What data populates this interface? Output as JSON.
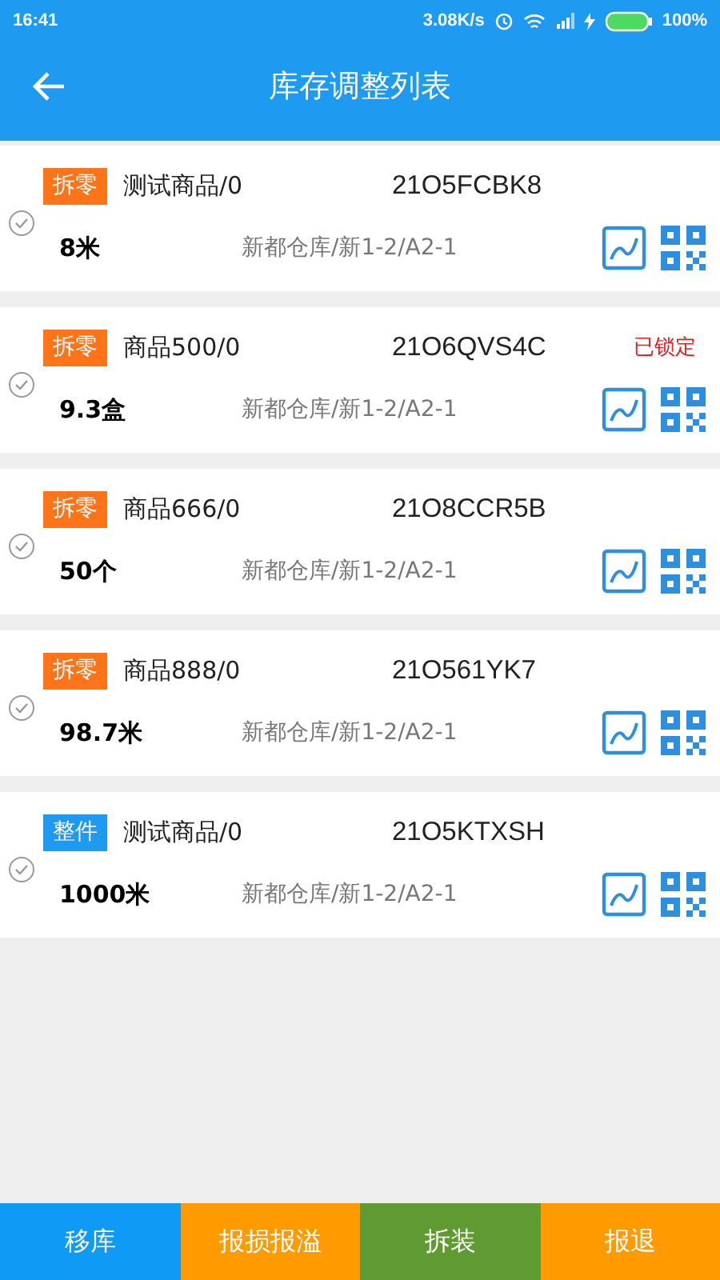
{
  "status_bar": {
    "time": "16:41",
    "speed": "3.08K/s",
    "battery": "100%"
  },
  "header": {
    "title": "库存调整列表"
  },
  "items": [
    {
      "tag": {
        "label": "拆零",
        "color": "#ff7418"
      },
      "name": "测试商品/0",
      "code": "21O5FCBK8",
      "quantity": "8米",
      "location": "新都仓库/新1-2/A2-1",
      "checked": false
    },
    {
      "tag": {
        "label": "拆零",
        "color": "#ff7418"
      },
      "name": "商品500/0",
      "code": "21O6QVS4C",
      "lock": "已锁定",
      "quantity": "9.3盒",
      "location": "新都仓库/新1-2/A2-1",
      "checked": false
    },
    {
      "tag": {
        "label": "拆零",
        "color": "#ff7418"
      },
      "name": "商品666/0",
      "code": "21O8CCR5B",
      "quantity": "50个",
      "location": "新都仓库/新1-2/A2-1",
      "checked": false
    },
    {
      "tag": {
        "label": "拆零",
        "color": "#ff7418"
      },
      "name": "商品888/0",
      "code": "21O561YK7",
      "quantity": "98.7米",
      "location": "新都仓库/新1-2/A2-1",
      "checked": false
    },
    {
      "tag": {
        "label": "整件",
        "color": "#1e9bf0"
      },
      "name": "测试商品/0",
      "code": "21O5KTXSH",
      "quantity": "1000米",
      "location": "新都仓库/新1-2/A2-1",
      "checked": false
    }
  ],
  "actions": [
    {
      "label": "移库",
      "color": "#0f9af5"
    },
    {
      "label": "报损报溢",
      "color": "#ff9a00"
    },
    {
      "label": "拆装",
      "color": "#5f9a32"
    },
    {
      "label": "报退",
      "color": "#ff9a00"
    }
  ]
}
